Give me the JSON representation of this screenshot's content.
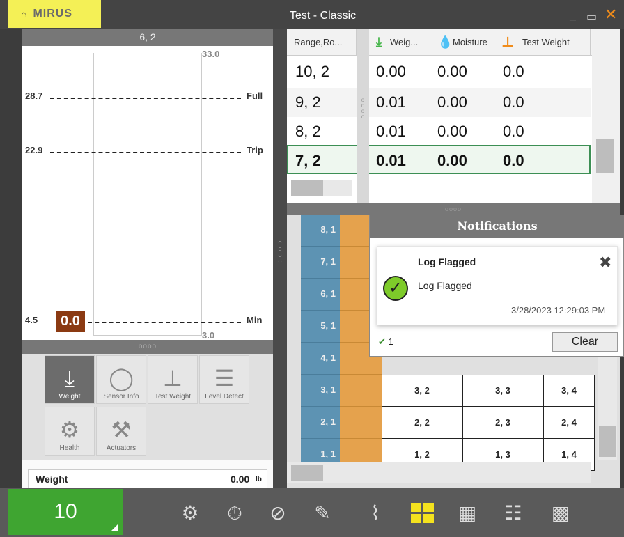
{
  "window": {
    "title": "Test - Classic",
    "brand": "MIRUS",
    "minimize": "_",
    "restore": "▭",
    "close": "✕"
  },
  "left_panel": {
    "header": "6, 2",
    "scale_top": "33.0",
    "scale_bottom": "3.0",
    "levels": [
      {
        "value": "28.7",
        "label": "Full"
      },
      {
        "value": "22.9",
        "label": "Trip"
      },
      {
        "value": "4.5",
        "label": "Min"
      }
    ],
    "reading": "0.0",
    "divider": "oooo",
    "tools": [
      "Weight",
      "Sensor Info",
      "Test Weight",
      "Level Detect",
      "Health",
      "Actuators"
    ],
    "weight_label": "Weight",
    "weight_value": "0.00",
    "weight_unit": "lb"
  },
  "table": {
    "columns": [
      "Range,Ro...",
      "Weig...",
      "Moisture",
      "Test Weight"
    ],
    "rows": [
      {
        "range": "10, 2",
        "weight": "0.00",
        "moisture": "0.00",
        "test_weight": "0.0"
      },
      {
        "range": "9, 2",
        "weight": "0.01",
        "moisture": "0.00",
        "test_weight": "0.0"
      },
      {
        "range": "8, 2",
        "weight": "0.01",
        "moisture": "0.00",
        "test_weight": "0.0"
      },
      {
        "range": "7, 2",
        "weight": "0.01",
        "moisture": "0.00",
        "test_weight": "0.0"
      }
    ],
    "divider": "oooo"
  },
  "grid": {
    "left_labels": [
      "8, 1",
      "7, 1",
      "6, 1",
      "5, 1",
      "4, 1",
      "3, 1",
      "2, 1",
      "1, 1"
    ],
    "rows": [
      [
        "3, 2",
        "3, 3",
        "3, 4"
      ],
      [
        "2, 2",
        "2, 3",
        "2, 4"
      ],
      [
        "1, 2",
        "1, 3",
        "1, 4"
      ]
    ]
  },
  "notifications": {
    "title": "Notifications",
    "item_title": "Log Flagged",
    "item_text": "Log Flagged",
    "timestamp": "3/28/2023 12:29:03 PM",
    "count": "1",
    "clear_label": "Clear",
    "close": "✖"
  },
  "bottom_bar": {
    "count": "10"
  }
}
